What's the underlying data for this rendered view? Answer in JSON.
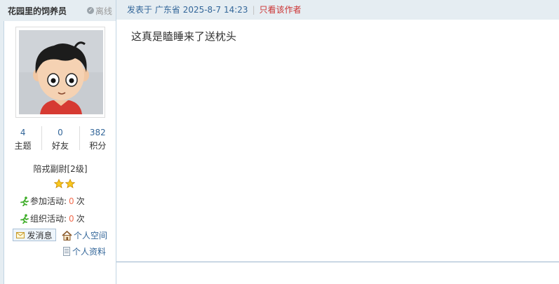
{
  "author": {
    "name": "花园里的饲养员",
    "status": "离线"
  },
  "stats": [
    {
      "value": "4",
      "label": "主题"
    },
    {
      "value": "0",
      "label": "好友"
    },
    {
      "value": "382",
      "label": "积分"
    }
  ],
  "rank": "陪戎副尉[2级]",
  "stars": 2,
  "activities": [
    {
      "label": "参加活动:",
      "count": "0",
      "unit": "次"
    },
    {
      "label": "组织活动:",
      "count": "0",
      "unit": "次"
    }
  ],
  "actions": {
    "message": "发消息",
    "space": "个人空间",
    "profile": "个人资料"
  },
  "post": {
    "prefix": "发表于",
    "location": "广东省",
    "datetime": "2025-8-7 14:23",
    "only_author": "只看该作者",
    "content": "这真是瞌睡来了送枕头"
  },
  "colors": {
    "sidebar_bg": "#e5edf2",
    "link": "#336699",
    "zero": "#f26c4f",
    "only_author": "#cc3333"
  }
}
